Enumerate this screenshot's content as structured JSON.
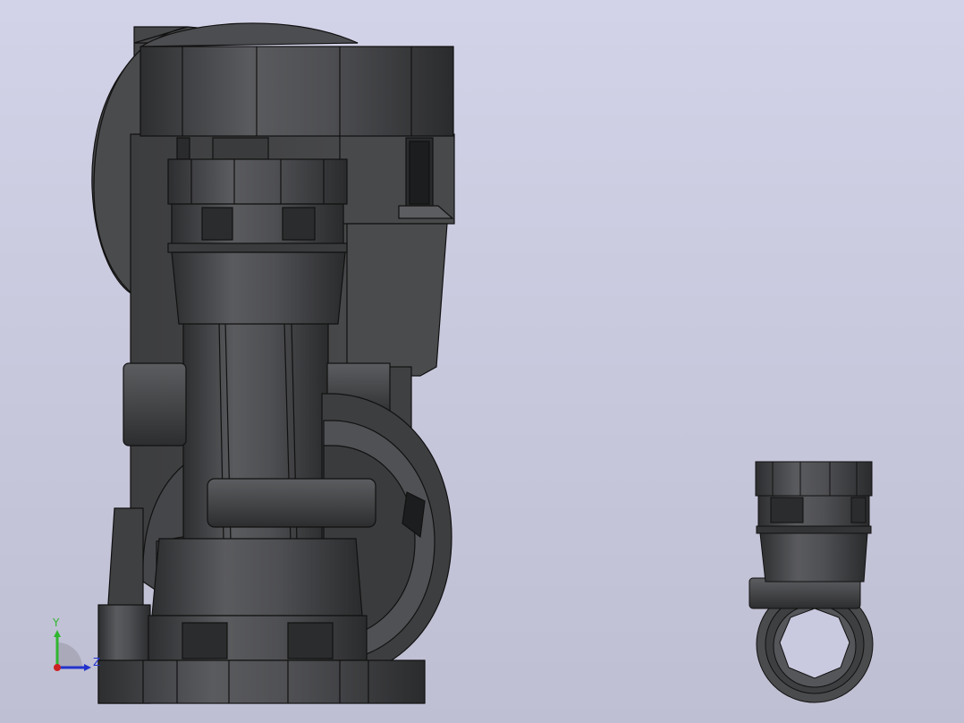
{
  "window": {
    "title": ""
  },
  "viewport": {
    "background_top": "#d2d2e8",
    "background_bottom": "#bfbfd3",
    "part_color": "#4a4b4d",
    "edge_color": "#111111",
    "render_style": "shaded-with-edges"
  },
  "triad": {
    "y_label": "Y",
    "z_label": "Z",
    "y_color": "#2fb52f",
    "z_color": "#2233cc",
    "x_color": "#cc2222"
  }
}
